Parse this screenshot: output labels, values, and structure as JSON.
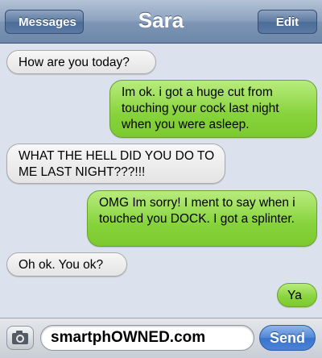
{
  "navbar": {
    "title": "Sara",
    "back_label": "Messages",
    "edit_label": "Edit"
  },
  "messages": [
    {
      "direction": "received",
      "text": "How are you today?"
    },
    {
      "direction": "sent",
      "text": "Im ok. i got a huge cut from touching your cock last night when you were asleep."
    },
    {
      "direction": "received",
      "text": "WHAT THE HELL DID YOU DO TO ME LAST NIGHT???!!!"
    },
    {
      "direction": "sent",
      "text": "OMG Im sorry! I ment to say when i touched you DOCK. I got a splinter."
    },
    {
      "direction": "received",
      "text": "Oh ok. You ok?"
    },
    {
      "direction": "sent",
      "text": "Ya"
    }
  ],
  "composer": {
    "text_value": "smartphOWNED.com",
    "send_label": "Send",
    "camera_icon": "camera-icon"
  },
  "colors": {
    "navbar": "#7e96b5",
    "background": "#dbe2ed",
    "received_bubble": "#e9e9e9",
    "sent_bubble": "#87d33c",
    "send_button": "#4f86d6"
  }
}
